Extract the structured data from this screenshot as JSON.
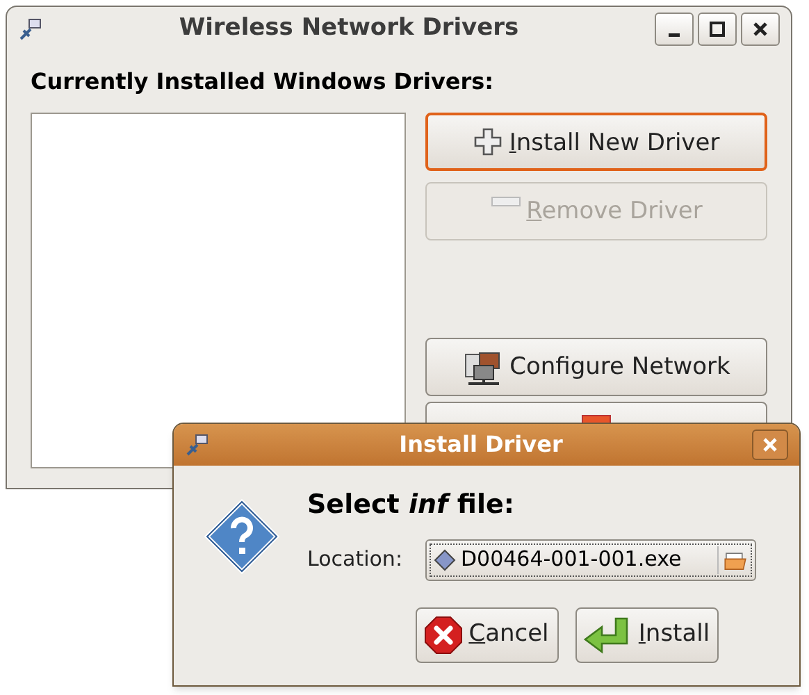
{
  "main_window": {
    "title": "Wireless Network Drivers",
    "heading": "Currently Installed Windows Drivers:",
    "buttons": [
      {
        "kind": "install",
        "label": "Install New Driver",
        "mnemonic": true,
        "disabled": false,
        "focused": true
      },
      {
        "kind": "remove",
        "label": "Remove Driver",
        "mnemonic": true,
        "disabled": true,
        "focused": false
      },
      {
        "kind": "configure",
        "label": "Configure Network",
        "mnemonic": false,
        "disabled": false,
        "focused": false
      },
      {
        "kind": "close",
        "disabled": false,
        "focused": false
      }
    ]
  },
  "dialog": {
    "title": "Install Driver",
    "prompt": "Select *inf* file:",
    "location_label": "Location:",
    "location_value": "D00464-001-001.exe",
    "buttons": [
      {
        "kind": "cancel",
        "label": "Cancel",
        "mnemonic": true
      },
      {
        "kind": "install",
        "label": "Install",
        "mnemonic": true
      }
    ]
  }
}
